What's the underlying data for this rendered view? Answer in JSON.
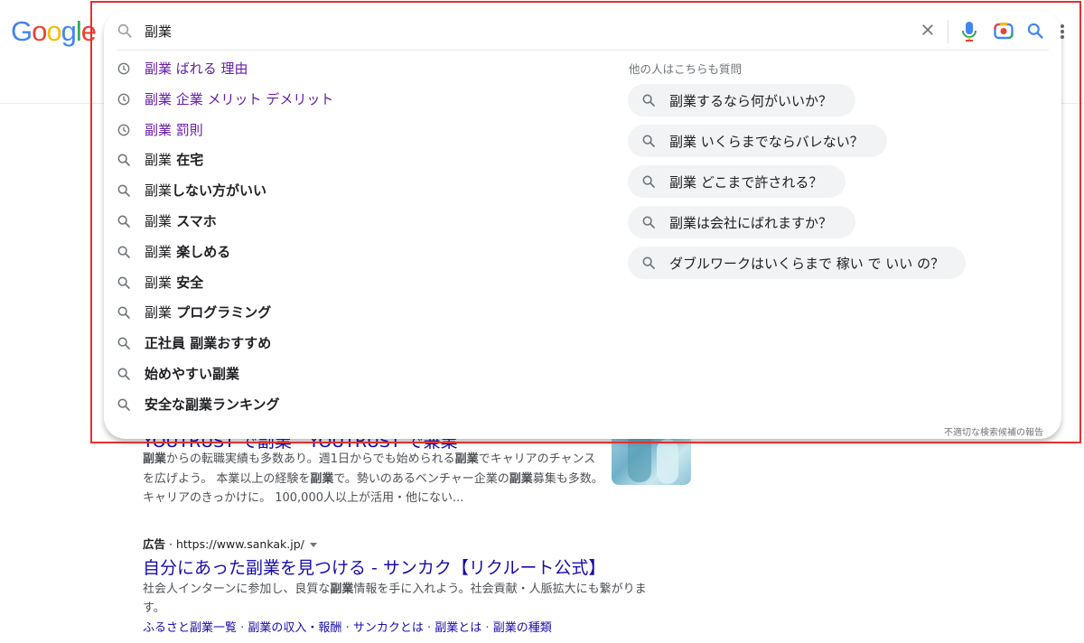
{
  "logo": {
    "letters": [
      "G",
      "o",
      "o",
      "g",
      "l",
      "e"
    ],
    "colors": [
      "#4285f4",
      "#ea4335",
      "#fbbc05",
      "#4285f4",
      "#34a853",
      "#ea4335"
    ]
  },
  "search": {
    "query": "副業"
  },
  "suggestions": [
    {
      "type": "history",
      "base": "副業",
      "rest": " ばれる 理由"
    },
    {
      "type": "history",
      "base": "副業",
      "rest": " 企業 メリット デメリット"
    },
    {
      "type": "history",
      "base": "副業",
      "rest": " 罰則"
    },
    {
      "type": "search",
      "base": "副業",
      "rest": " 在宅"
    },
    {
      "type": "search",
      "base": "副業",
      "rest": "しない方がいい"
    },
    {
      "type": "search",
      "base": "副業",
      "rest": " スマホ"
    },
    {
      "type": "search",
      "base": "副業",
      "rest": " 楽しめる"
    },
    {
      "type": "search",
      "base": "副業",
      "rest": " 安全"
    },
    {
      "type": "search",
      "base": "副業",
      "rest": " プログラミング"
    },
    {
      "type": "search",
      "base": "",
      "rest": "正社員 副業おすすめ"
    },
    {
      "type": "search",
      "base": "",
      "rest": "始めやすい副業"
    },
    {
      "type": "search",
      "base": "",
      "rest": "安全な副業ランキング"
    }
  ],
  "people_also_ask": {
    "heading": "他の人はこちらも質問",
    "items": [
      "副業するなら何がいいか？",
      "副業 いくらまでならバレない？",
      "副業 どこまで許される？",
      "副業は会社にばれますか？",
      "ダブルワークはいくらまで 稼い で いい の？"
    ]
  },
  "report_link": "不適切な検索候補の報告",
  "results": {
    "r1_title": "YOUTRUST で副業 - YOUTRUST で兼業",
    "r1_snippet": [
      {
        "t": "副業",
        "b": true
      },
      {
        "t": "からの転職実績も多数あり。週1日からでも始められる",
        "b": false
      },
      {
        "t": "副業",
        "b": true
      },
      {
        "t": "でキャリアのチャンスを広げよう。 本業以上の経験を",
        "b": false
      },
      {
        "t": "副業",
        "b": true
      },
      {
        "t": "で。勢いのあるベンチャー企業の",
        "b": false
      },
      {
        "t": "副業",
        "b": true
      },
      {
        "t": "募集も多数。キャリアのきっかけに。 100,000人以上が活用・他にない...",
        "b": false
      }
    ],
    "ad_label": "広告",
    "ad_url": "https://www.sankak.jp/",
    "r2_title": "自分にあった副業を見つける - サンカク【リクルート公式】",
    "r2_snippet": [
      {
        "t": "社会人インターンに参加し、良質な",
        "b": false
      },
      {
        "t": "副業",
        "b": true
      },
      {
        "t": "情報を手に入れよう。社会貢献・人脈拡大にも繋がります。",
        "b": false
      }
    ],
    "r2_links": [
      "ふるさと副業一覧",
      "副業の収入・報酬",
      "サンカクとは",
      "副業とは",
      "副業の種類"
    ]
  }
}
